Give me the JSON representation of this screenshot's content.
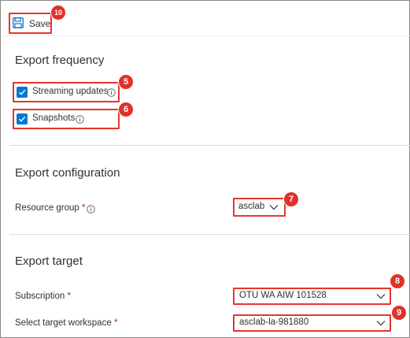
{
  "toolbar": {
    "save_label": "Save",
    "save_badge": "10"
  },
  "export_frequency": {
    "title": "Export frequency",
    "streaming_updates": {
      "label": "Streaming updates",
      "checked": true,
      "badge": "5"
    },
    "snapshots": {
      "label": "Snapshots",
      "checked": true,
      "badge": "6"
    }
  },
  "export_configuration": {
    "title": "Export configuration",
    "resource_group": {
      "label": "Resource group",
      "required_mark": "*",
      "value": "asclab",
      "badge": "7"
    }
  },
  "export_target": {
    "title": "Export target",
    "subscription": {
      "label": "Subscription",
      "required_mark": "*",
      "value": "OTU WA AIW 101528",
      "badge": "8"
    },
    "target_workspace": {
      "label": "Select target workspace",
      "required_mark": "*",
      "value": "asclab-la-981880",
      "badge": "9"
    }
  },
  "colors": {
    "accent": "#0078d4",
    "callout": "#e8352c",
    "required": "#a4262c"
  },
  "icons": [
    "save-icon",
    "info-icon",
    "chevron-down-icon",
    "checkmark-icon"
  ]
}
